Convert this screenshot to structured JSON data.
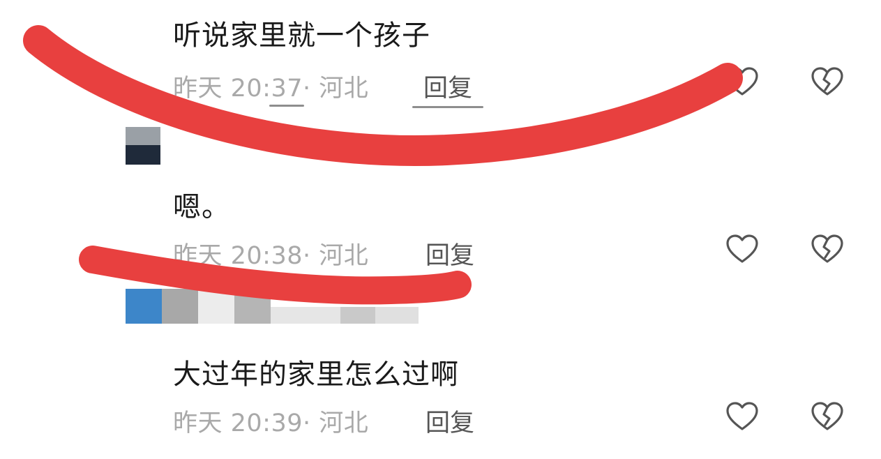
{
  "comments": [
    {
      "text": "听说家里就一个孩子",
      "meta": "昨天 20:37· 河北",
      "reply": "回复"
    },
    {
      "text": "嗯。",
      "meta": "昨天 20:38· 河北",
      "reply": "回复"
    },
    {
      "text": "大过年的家里怎么过啊",
      "meta": "昨天 20:39· 河北",
      "reply": "回复"
    }
  ],
  "icons": {
    "like": "heart-outline-icon",
    "dislike": "broken-heart-outline-icon"
  },
  "colors": {
    "scribble": "#e8403f",
    "text": "#1a1a1a",
    "meta": "#a9a9a9",
    "icon": "#555555"
  }
}
